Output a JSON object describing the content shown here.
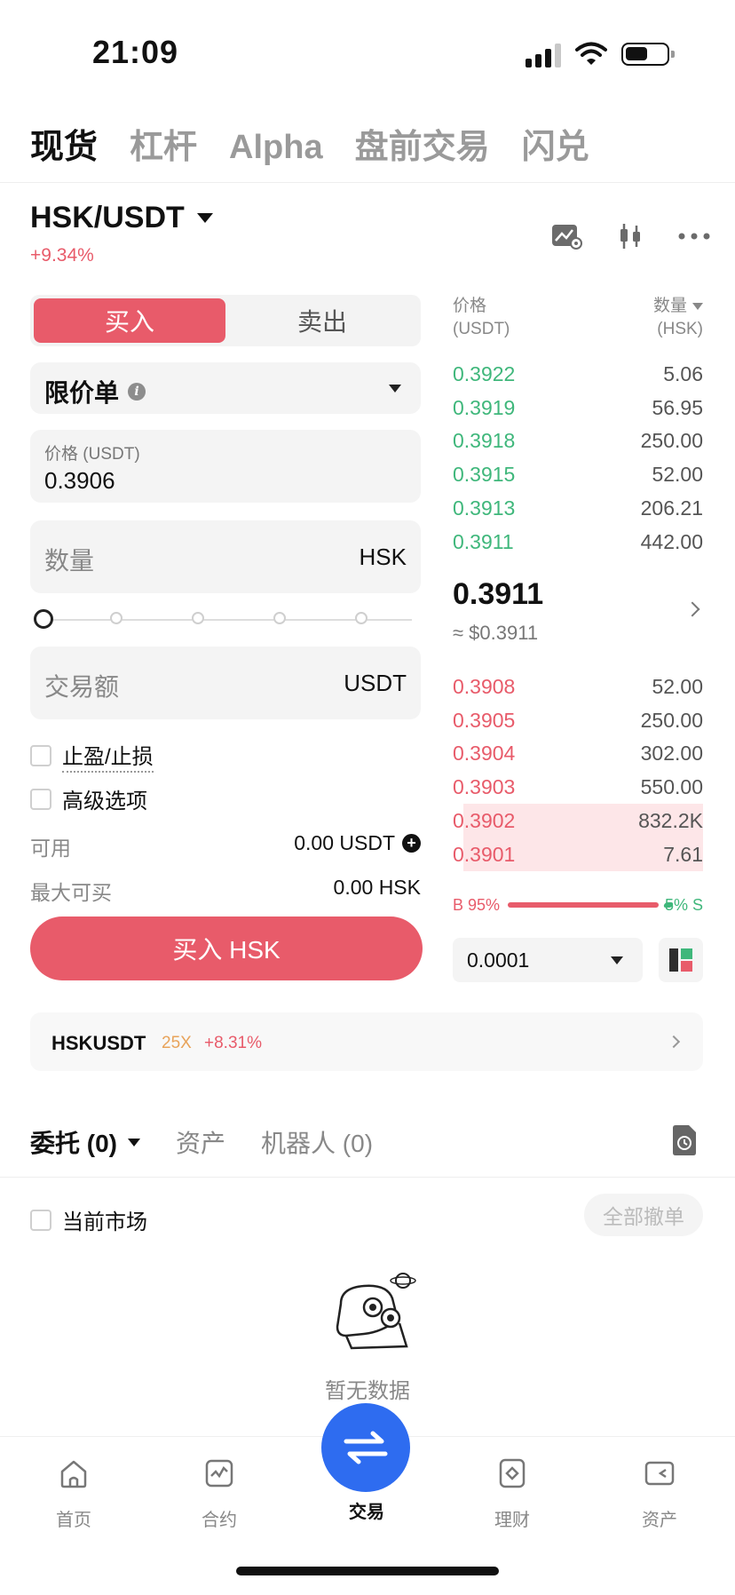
{
  "status_bar": {
    "time": "21:09"
  },
  "top_tabs": [
    {
      "label": "现货",
      "active": true
    },
    {
      "label": "杠杆",
      "active": false
    },
    {
      "label": "Alpha",
      "active": false
    },
    {
      "label": "盘前交易",
      "active": false
    },
    {
      "label": "闪兑",
      "active": false
    }
  ],
  "pair": {
    "symbol": "HSK/USDT",
    "change": "+9.34%"
  },
  "header_icons": [
    "chart-settings-icon",
    "candlestick-icon",
    "more-icon"
  ],
  "order_form": {
    "buy_label": "买入",
    "sell_label": "卖出",
    "order_type": "限价单",
    "price_caption": "价格 (USDT)",
    "price_value": "0.3906",
    "qty_placeholder": "数量",
    "qty_unit": "HSK",
    "amount_placeholder": "交易额",
    "amount_unit": "USDT",
    "slider_percent": 0,
    "tp_sl_label": "止盈/止损",
    "advanced_label": "高级选项",
    "available_label": "可用",
    "available_value": "0.00 USDT",
    "max_buy_label": "最大可买",
    "max_buy_value": "0.00 HSK",
    "submit_label": "买入 HSK"
  },
  "order_book": {
    "price_header": "价格",
    "price_unit": "(USDT)",
    "qty_header": "数量",
    "qty_unit": "(HSK)",
    "asks": [
      {
        "price": "0.3922",
        "qty": "5.06"
      },
      {
        "price": "0.3919",
        "qty": "56.95"
      },
      {
        "price": "0.3918",
        "qty": "250.00"
      },
      {
        "price": "0.3915",
        "qty": "52.00"
      },
      {
        "price": "0.3913",
        "qty": "206.21"
      },
      {
        "price": "0.3911",
        "qty": "442.00"
      }
    ],
    "last_price": "0.3911",
    "last_price_usd": "≈ $0.3911",
    "bids": [
      {
        "price": "0.3908",
        "qty": "52.00"
      },
      {
        "price": "0.3905",
        "qty": "250.00"
      },
      {
        "price": "0.3904",
        "qty": "302.00"
      },
      {
        "price": "0.3903",
        "qty": "550.00"
      },
      {
        "price": "0.3902",
        "qty": "832.2K",
        "depth": 1.0
      },
      {
        "price": "0.3901",
        "qty": "7.61",
        "depth": 1.0
      }
    ],
    "buy_ratio_label": "B 95%",
    "sell_ratio_label": "5% S",
    "tick_size": "0.0001"
  },
  "banner": {
    "symbol": "HSKUSDT",
    "leverage": "25X",
    "change": "+8.31%"
  },
  "orders_section": {
    "tab_orders": "委托 (0)",
    "tab_assets": "资产",
    "tab_bots": "机器人 (0)",
    "current_market_label": "当前市场",
    "cancel_all_label": "全部撤单",
    "empty_text": "暂无数据"
  },
  "bottom_nav": [
    {
      "label": "首页",
      "icon": "home-icon"
    },
    {
      "label": "合约",
      "icon": "futures-icon"
    },
    {
      "label": "交易",
      "icon": "trade-icon",
      "active": true
    },
    {
      "label": "理财",
      "icon": "earn-icon"
    },
    {
      "label": "资产",
      "icon": "wallet-icon"
    }
  ],
  "colors": {
    "buy": "#e85b6a",
    "sell": "#3fb77b",
    "fab": "#2e6cf0"
  }
}
